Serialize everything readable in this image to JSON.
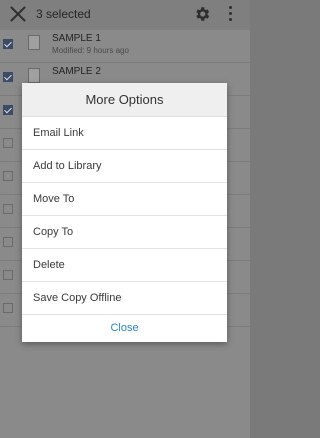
{
  "header": {
    "selected_text": "3 selected"
  },
  "list": {
    "items": [
      {
        "title": "SAMPLE 1",
        "subtitle": "Modified: 9 hours ago"
      },
      {
        "title": "SAMPLE 2",
        "subtitle": ""
      }
    ]
  },
  "dialog": {
    "title": "More Options",
    "options": [
      {
        "label": "Email Link"
      },
      {
        "label": "Add to Library"
      },
      {
        "label": "Move To"
      },
      {
        "label": "Copy To"
      },
      {
        "label": "Delete"
      },
      {
        "label": "Save Copy Offline"
      }
    ],
    "close_label": "Close"
  },
  "colors": {
    "accent": "#2d84c6",
    "overlay": "#8a8a8a",
    "checkbox_checked": "#3c4c66"
  },
  "icons": [
    "close-icon",
    "gear-icon",
    "overflow-menu-icon",
    "document-icon",
    "checkbox-icon"
  ]
}
